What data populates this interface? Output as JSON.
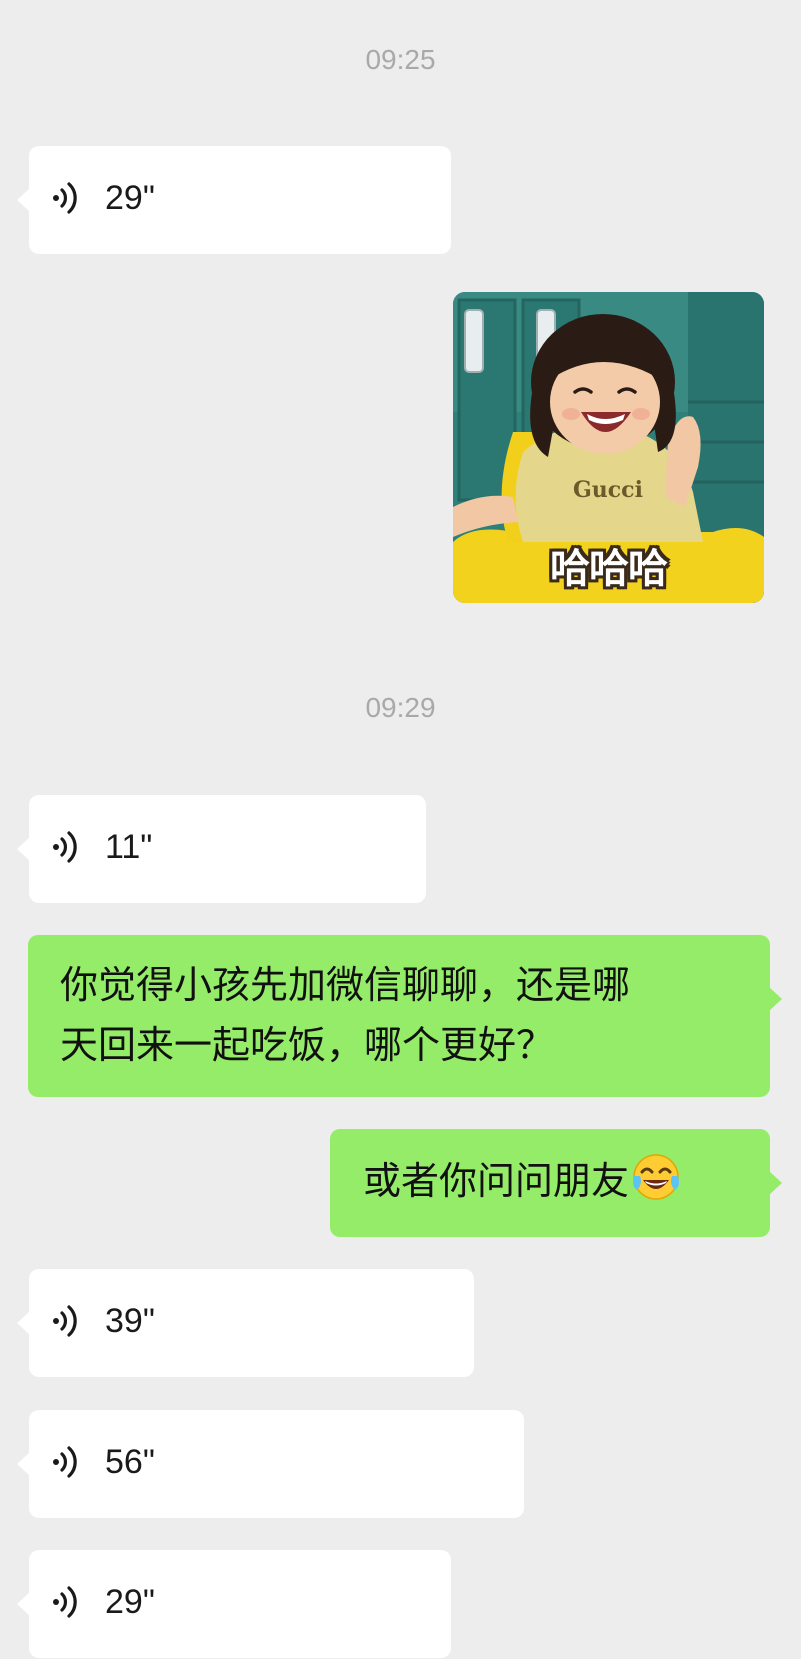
{
  "chat": {
    "timestamps": [
      "09:25",
      "09:29"
    ],
    "voice_messages": [
      {
        "duration": "29\""
      },
      {
        "duration": "11\""
      },
      {
        "duration": "39\""
      },
      {
        "duration": "56\""
      },
      {
        "duration": "29\""
      }
    ],
    "sticker": {
      "caption": "哈哈哈"
    },
    "outgoing_messages": [
      {
        "lines": [
          "你觉得小孩先加微信聊聊，还是哪",
          "天回来一起吃饭，哪个更好？"
        ]
      },
      {
        "text": "或者你问问朋友",
        "emoji": "tears-of-joy-emoji"
      }
    ]
  },
  "colors": {
    "background": "#ededed",
    "incoming_bubble": "#ffffff",
    "outgoing_bubble": "#95ec69",
    "timestamp": "#a9a9a9"
  }
}
